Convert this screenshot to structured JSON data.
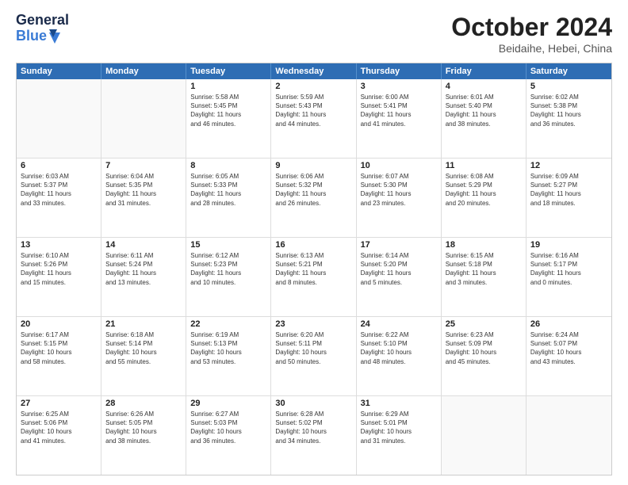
{
  "header": {
    "logo_general": "General",
    "logo_blue": "Blue",
    "title": "October 2024",
    "location": "Beidaihe, Hebei, China"
  },
  "days_of_week": [
    "Sunday",
    "Monday",
    "Tuesday",
    "Wednesday",
    "Thursday",
    "Friday",
    "Saturday"
  ],
  "weeks": [
    {
      "cells": [
        {
          "day": "",
          "empty": true
        },
        {
          "day": "",
          "empty": true
        },
        {
          "day": "1",
          "sunrise": "5:58 AM",
          "sunset": "5:45 PM",
          "daylight": "11 hours and 46 minutes."
        },
        {
          "day": "2",
          "sunrise": "5:59 AM",
          "sunset": "5:43 PM",
          "daylight": "11 hours and 44 minutes."
        },
        {
          "day": "3",
          "sunrise": "6:00 AM",
          "sunset": "5:41 PM",
          "daylight": "11 hours and 41 minutes."
        },
        {
          "day": "4",
          "sunrise": "6:01 AM",
          "sunset": "5:40 PM",
          "daylight": "11 hours and 38 minutes."
        },
        {
          "day": "5",
          "sunrise": "6:02 AM",
          "sunset": "5:38 PM",
          "daylight": "11 hours and 36 minutes."
        }
      ]
    },
    {
      "cells": [
        {
          "day": "6",
          "sunrise": "6:03 AM",
          "sunset": "5:37 PM",
          "daylight": "11 hours and 33 minutes."
        },
        {
          "day": "7",
          "sunrise": "6:04 AM",
          "sunset": "5:35 PM",
          "daylight": "11 hours and 31 minutes."
        },
        {
          "day": "8",
          "sunrise": "6:05 AM",
          "sunset": "5:33 PM",
          "daylight": "11 hours and 28 minutes."
        },
        {
          "day": "9",
          "sunrise": "6:06 AM",
          "sunset": "5:32 PM",
          "daylight": "11 hours and 26 minutes."
        },
        {
          "day": "10",
          "sunrise": "6:07 AM",
          "sunset": "5:30 PM",
          "daylight": "11 hours and 23 minutes."
        },
        {
          "day": "11",
          "sunrise": "6:08 AM",
          "sunset": "5:29 PM",
          "daylight": "11 hours and 20 minutes."
        },
        {
          "day": "12",
          "sunrise": "6:09 AM",
          "sunset": "5:27 PM",
          "daylight": "11 hours and 18 minutes."
        }
      ]
    },
    {
      "cells": [
        {
          "day": "13",
          "sunrise": "6:10 AM",
          "sunset": "5:26 PM",
          "daylight": "11 hours and 15 minutes."
        },
        {
          "day": "14",
          "sunrise": "6:11 AM",
          "sunset": "5:24 PM",
          "daylight": "11 hours and 13 minutes."
        },
        {
          "day": "15",
          "sunrise": "6:12 AM",
          "sunset": "5:23 PM",
          "daylight": "11 hours and 10 minutes."
        },
        {
          "day": "16",
          "sunrise": "6:13 AM",
          "sunset": "5:21 PM",
          "daylight": "11 hours and 8 minutes."
        },
        {
          "day": "17",
          "sunrise": "6:14 AM",
          "sunset": "5:20 PM",
          "daylight": "11 hours and 5 minutes."
        },
        {
          "day": "18",
          "sunrise": "6:15 AM",
          "sunset": "5:18 PM",
          "daylight": "11 hours and 3 minutes."
        },
        {
          "day": "19",
          "sunrise": "6:16 AM",
          "sunset": "5:17 PM",
          "daylight": "11 hours and 0 minutes."
        }
      ]
    },
    {
      "cells": [
        {
          "day": "20",
          "sunrise": "6:17 AM",
          "sunset": "5:15 PM",
          "daylight": "10 hours and 58 minutes."
        },
        {
          "day": "21",
          "sunrise": "6:18 AM",
          "sunset": "5:14 PM",
          "daylight": "10 hours and 55 minutes."
        },
        {
          "day": "22",
          "sunrise": "6:19 AM",
          "sunset": "5:13 PM",
          "daylight": "10 hours and 53 minutes."
        },
        {
          "day": "23",
          "sunrise": "6:20 AM",
          "sunset": "5:11 PM",
          "daylight": "10 hours and 50 minutes."
        },
        {
          "day": "24",
          "sunrise": "6:22 AM",
          "sunset": "5:10 PM",
          "daylight": "10 hours and 48 minutes."
        },
        {
          "day": "25",
          "sunrise": "6:23 AM",
          "sunset": "5:09 PM",
          "daylight": "10 hours and 45 minutes."
        },
        {
          "day": "26",
          "sunrise": "6:24 AM",
          "sunset": "5:07 PM",
          "daylight": "10 hours and 43 minutes."
        }
      ]
    },
    {
      "cells": [
        {
          "day": "27",
          "sunrise": "6:25 AM",
          "sunset": "5:06 PM",
          "daylight": "10 hours and 41 minutes."
        },
        {
          "day": "28",
          "sunrise": "6:26 AM",
          "sunset": "5:05 PM",
          "daylight": "10 hours and 38 minutes."
        },
        {
          "day": "29",
          "sunrise": "6:27 AM",
          "sunset": "5:03 PM",
          "daylight": "10 hours and 36 minutes."
        },
        {
          "day": "30",
          "sunrise": "6:28 AM",
          "sunset": "5:02 PM",
          "daylight": "10 hours and 34 minutes."
        },
        {
          "day": "31",
          "sunrise": "6:29 AM",
          "sunset": "5:01 PM",
          "daylight": "10 hours and 31 minutes."
        },
        {
          "day": "",
          "empty": true
        },
        {
          "day": "",
          "empty": true
        }
      ]
    }
  ],
  "labels": {
    "sunrise": "Sunrise:",
    "sunset": "Sunset:",
    "daylight": "Daylight:"
  }
}
